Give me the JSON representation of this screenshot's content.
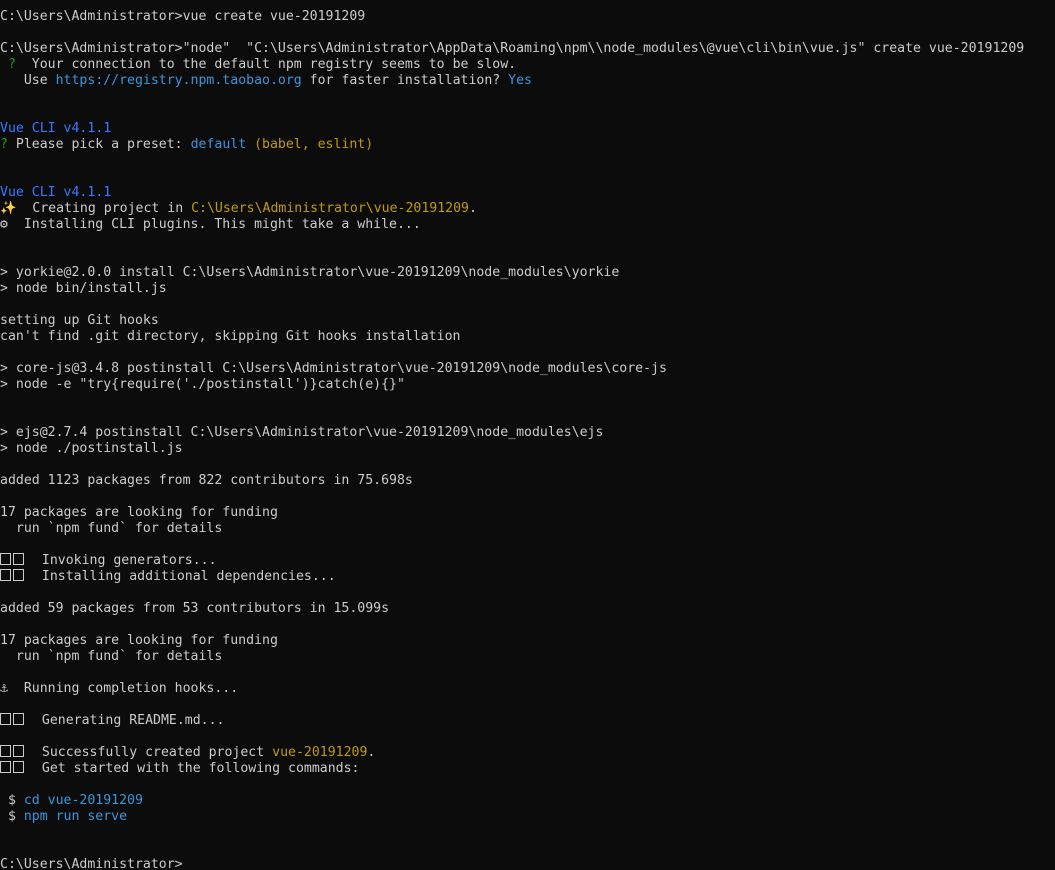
{
  "terminal": {
    "lines": [
      {
        "type": "text",
        "segments": [
          {
            "text": "C:\\Users\\Administrator>vue create vue-20191209",
            "color": "white"
          }
        ]
      },
      {
        "type": "blank"
      },
      {
        "type": "text",
        "segments": [
          {
            "text": "C:\\Users\\Administrator>\"node\"  \"C:\\Users\\Administrator\\AppData\\Roaming\\npm\\\\node_modules\\@vue\\cli\\bin\\vue.js\" create vue-20191209",
            "color": "white"
          }
        ]
      },
      {
        "type": "text",
        "segments": [
          {
            "text": " ?",
            "color": "green"
          },
          {
            "text": "  Your connection to the default npm registry seems to be slow.",
            "color": "white"
          }
        ]
      },
      {
        "type": "text",
        "segments": [
          {
            "text": "   Use ",
            "color": "white"
          },
          {
            "text": "https://registry.npm.taobao.org",
            "color": "cyan"
          },
          {
            "text": " for faster installation? ",
            "color": "white"
          },
          {
            "text": "Yes",
            "color": "cyan"
          }
        ]
      },
      {
        "type": "blank"
      },
      {
        "type": "blank"
      },
      {
        "type": "text",
        "segments": [
          {
            "text": "Vue CLI v4.1.1",
            "color": "blue"
          }
        ]
      },
      {
        "type": "text",
        "segments": [
          {
            "text": "?",
            "color": "green"
          },
          {
            "text": " Please pick a preset: ",
            "color": "white"
          },
          {
            "text": "default",
            "color": "cyan"
          },
          {
            "text": " (babel, eslint)",
            "color": "yellow"
          }
        ]
      },
      {
        "type": "blank"
      },
      {
        "type": "blank"
      },
      {
        "type": "text",
        "segments": [
          {
            "text": "Vue CLI v4.1.1",
            "color": "blue"
          }
        ]
      },
      {
        "type": "text",
        "segments": [
          {
            "text": "✨  Creating project in ",
            "color": "white"
          },
          {
            "text": "C:\\Users\\Administrator\\vue-20191209",
            "color": "yellow"
          },
          {
            "text": ".",
            "color": "white"
          }
        ]
      },
      {
        "type": "text",
        "segments": [
          {
            "text": "⚙  Installing CLI plugins. This might take a while...",
            "color": "white"
          }
        ]
      },
      {
        "type": "blank"
      },
      {
        "type": "blank"
      },
      {
        "type": "text",
        "segments": [
          {
            "text": "> yorkie@2.0.0 install C:\\Users\\Administrator\\vue-20191209\\node_modules\\yorkie",
            "color": "white"
          }
        ]
      },
      {
        "type": "text",
        "segments": [
          {
            "text": "> node bin/install.js",
            "color": "white"
          }
        ]
      },
      {
        "type": "blank"
      },
      {
        "type": "text",
        "segments": [
          {
            "text": "setting up Git hooks",
            "color": "white"
          }
        ]
      },
      {
        "type": "text",
        "segments": [
          {
            "text": "can't find .git directory, skipping Git hooks installation",
            "color": "white"
          }
        ]
      },
      {
        "type": "blank"
      },
      {
        "type": "text",
        "segments": [
          {
            "text": "> core-js@3.4.8 postinstall C:\\Users\\Administrator\\vue-20191209\\node_modules\\core-js",
            "color": "white"
          }
        ]
      },
      {
        "type": "text",
        "segments": [
          {
            "text": "> node -e \"try{require('./postinstall')}catch(e){}\"",
            "color": "white"
          }
        ]
      },
      {
        "type": "blank"
      },
      {
        "type": "blank"
      },
      {
        "type": "text",
        "segments": [
          {
            "text": "> ejs@2.7.4 postinstall C:\\Users\\Administrator\\vue-20191209\\node_modules\\ejs",
            "color": "white"
          }
        ]
      },
      {
        "type": "text",
        "segments": [
          {
            "text": "> node ./postinstall.js",
            "color": "white"
          }
        ]
      },
      {
        "type": "blank"
      },
      {
        "type": "text",
        "segments": [
          {
            "text": "added 1123 packages from 822 contributors in 75.698s",
            "color": "white"
          }
        ]
      },
      {
        "type": "blank"
      },
      {
        "type": "text",
        "segments": [
          {
            "text": "17 packages are looking for funding",
            "color": "white"
          }
        ]
      },
      {
        "type": "text",
        "segments": [
          {
            "text": "  run `npm fund` for details",
            "color": "white"
          }
        ]
      },
      {
        "type": "blank"
      },
      {
        "type": "boxed",
        "segments": [
          {
            "text": "  Invoking generators...",
            "color": "white"
          }
        ]
      },
      {
        "type": "boxed",
        "segments": [
          {
            "text": "  Installing additional dependencies...",
            "color": "white"
          }
        ]
      },
      {
        "type": "blank"
      },
      {
        "type": "text",
        "segments": [
          {
            "text": "added 59 packages from 53 contributors in 15.099s",
            "color": "white"
          }
        ]
      },
      {
        "type": "blank"
      },
      {
        "type": "text",
        "segments": [
          {
            "text": "17 packages are looking for funding",
            "color": "white"
          }
        ]
      },
      {
        "type": "text",
        "segments": [
          {
            "text": "  run `npm fund` for details",
            "color": "white"
          }
        ]
      },
      {
        "type": "blank"
      },
      {
        "type": "text",
        "segments": [
          {
            "text": "⚓  Running completion hooks...",
            "color": "white"
          }
        ]
      },
      {
        "type": "blank"
      },
      {
        "type": "boxed",
        "segments": [
          {
            "text": "  Generating README.md...",
            "color": "white"
          }
        ]
      },
      {
        "type": "blank"
      },
      {
        "type": "boxed",
        "segments": [
          {
            "text": "  Successfully created project ",
            "color": "white"
          },
          {
            "text": "vue-20191209",
            "color": "yellow"
          },
          {
            "text": ".",
            "color": "white"
          }
        ]
      },
      {
        "type": "boxed",
        "segments": [
          {
            "text": "  Get started with the following commands:",
            "color": "white"
          }
        ]
      },
      {
        "type": "blank"
      },
      {
        "type": "text",
        "segments": [
          {
            "text": " $ ",
            "color": "white"
          },
          {
            "text": "cd vue-20191209",
            "color": "cyan"
          }
        ]
      },
      {
        "type": "text",
        "segments": [
          {
            "text": " $ ",
            "color": "white"
          },
          {
            "text": "npm run serve",
            "color": "cyan"
          }
        ]
      },
      {
        "type": "blank"
      },
      {
        "type": "blank"
      },
      {
        "type": "text",
        "segments": [
          {
            "text": "C:\\Users\\Administrator>",
            "color": "white"
          }
        ]
      }
    ]
  },
  "colors": {
    "background": "#0c0c0c",
    "white": "#cccccc",
    "blue": "#3b78ff",
    "green": "#13a10e",
    "yellow": "#c19c00",
    "cyan": "#3a96dd"
  }
}
